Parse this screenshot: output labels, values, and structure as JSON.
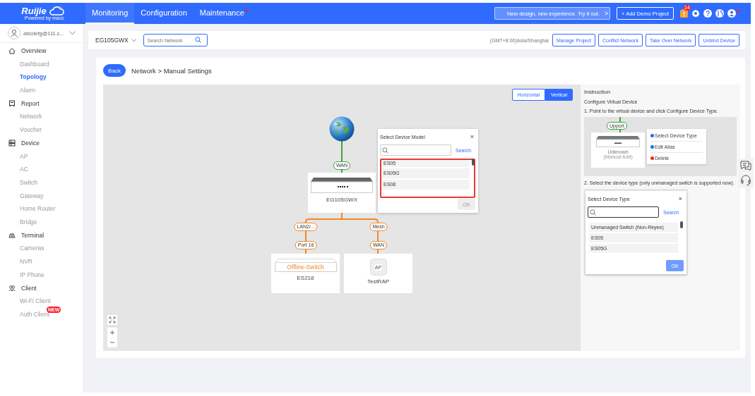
{
  "header": {
    "logo": "Ruijie",
    "tagline": "Powered by macc",
    "nav": [
      {
        "label": "Monitoring",
        "selected": true,
        "dot": false
      },
      {
        "label": "Configuration",
        "selected": false,
        "dot": false
      },
      {
        "label": "Maintenance",
        "selected": false,
        "dot": true
      }
    ],
    "promo": "New design, new experience. Try it out.",
    "promo_arrow": ">",
    "add_demo": "+ Add Demo Project",
    "notification_count": "14",
    "user_alert": true
  },
  "sidebar": {
    "account": "abcdefg@111.c...",
    "sections": [
      {
        "label": "Overview",
        "items": [
          {
            "label": "Dashboard",
            "selected": false
          },
          {
            "label": "Topology",
            "selected": true
          },
          {
            "label": "Alarm",
            "selected": false
          }
        ]
      },
      {
        "label": "Report",
        "items": [
          {
            "label": "Network",
            "selected": false
          },
          {
            "label": "Voucher",
            "selected": false
          }
        ]
      },
      {
        "label": "Device",
        "items": [
          {
            "label": "AP",
            "selected": false
          },
          {
            "label": "AC",
            "selected": false
          },
          {
            "label": "Switch",
            "selected": false
          },
          {
            "label": "Gateway",
            "selected": false
          },
          {
            "label": "Home Router",
            "selected": false
          },
          {
            "label": "Bridge",
            "selected": false
          }
        ]
      },
      {
        "label": "Terminal",
        "items": [
          {
            "label": "Cameras",
            "selected": false
          },
          {
            "label": "NVR",
            "selected": false
          },
          {
            "label": "IP Phone",
            "selected": false
          }
        ]
      },
      {
        "label": "Client",
        "items": [
          {
            "label": "Wi-Fi Client",
            "selected": false
          },
          {
            "label": "Auth Client",
            "selected": false,
            "badge": "NEW"
          }
        ]
      }
    ]
  },
  "toolbar": {
    "network": "EG105GWX",
    "search": {
      "placeholder": "Search Network"
    },
    "timezone": "(GMT+8:00)Asia/Shanghai",
    "buttons": [
      "Manage Project",
      "Conflict Network",
      "Take Over Network",
      "Unbind Device"
    ]
  },
  "page": {
    "back": "Back",
    "breadcrumb": "Network > Manual Settings"
  },
  "layout_toggle": [
    {
      "label": "Horizontal",
      "selected": false
    },
    {
      "label": "Vertical",
      "selected": true
    }
  ],
  "topology": {
    "wan_label": "WAN",
    "gateway": {
      "name": "EG105GWX"
    },
    "branches": [
      {
        "uplink": "LAN2/...",
        "port": "Port 16",
        "device": {
          "kind": "switch",
          "name": "ES218",
          "status": "Offline-Switch"
        }
      },
      {
        "uplink": "Mesh",
        "port": "WAN",
        "device": {
          "kind": "ap",
          "name": "TestRAP",
          "badge": "AP"
        }
      }
    ]
  },
  "model_dialog": {
    "title": "Select Device Model",
    "close": "×",
    "search_button": "Search",
    "search_focused": false,
    "options": [
      "ES05",
      "ES05G",
      "ES08"
    ],
    "highlighted": true,
    "ok": "OK",
    "ok_disabled": true
  },
  "instruction": {
    "title": "Instruction",
    "subtitle": "Configure Virtual Device",
    "step1": "1. Point to the virtual device and click Configure Device Type.",
    "example1": {
      "port": "Upport",
      "device": "Unknown",
      "note": "(Manual Add)",
      "menu": [
        {
          "label": "Select Device Type",
          "color": "#1e6bff"
        },
        {
          "label": "Edit Alias",
          "color": "#1e6bff"
        },
        {
          "label": "Delete",
          "color": "#f5222d"
        }
      ]
    },
    "step2": "2. Select the device type (only unmanaged switch is supported now).",
    "example2": {
      "title": "Select Device Type",
      "close": "×",
      "search_button": "Search",
      "search_focused": true,
      "options": [
        "Unmanaged Switch (Non-Reyee)",
        "ES05",
        "ES05G"
      ],
      "highlighted": false,
      "ok": "OK",
      "ok_disabled": false
    }
  }
}
